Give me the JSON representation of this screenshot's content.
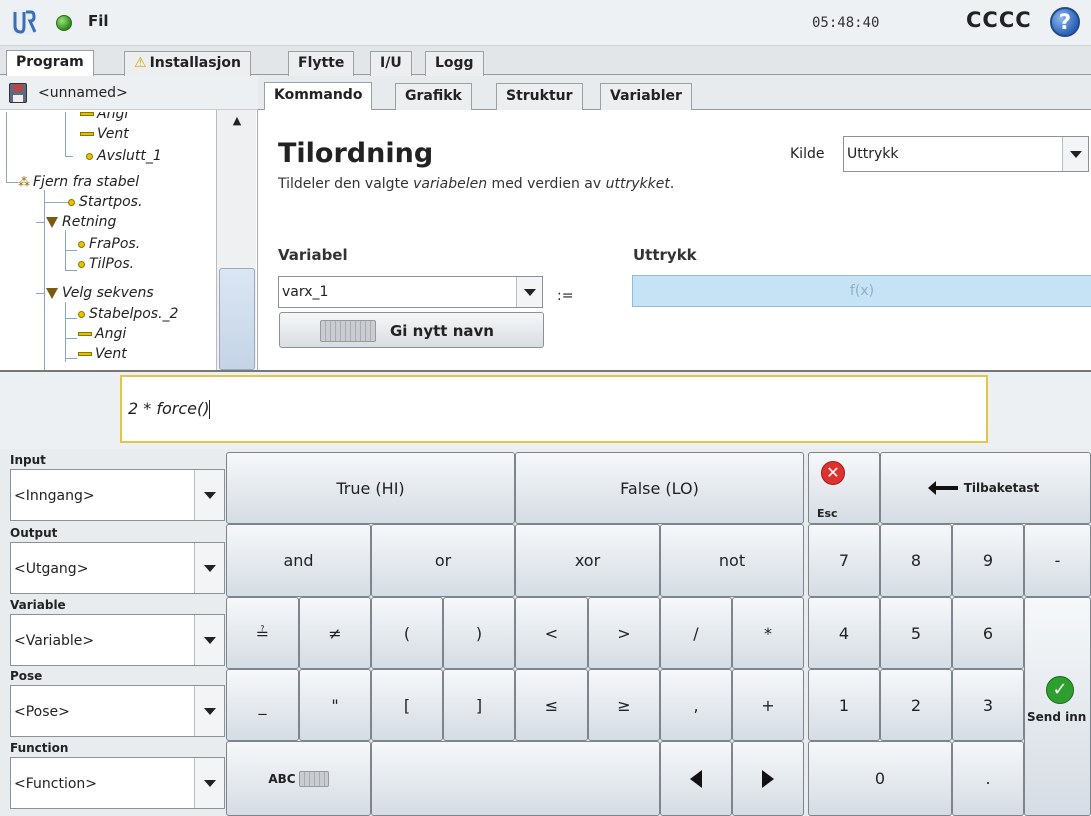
{
  "titlebar": {
    "title": "Fil",
    "time": "05:48:40",
    "robot_name": "CCCC",
    "help": "?"
  },
  "main_tabs": [
    "Program",
    "Installasjon",
    "Flytte",
    "I/U",
    "Logg"
  ],
  "tree": {
    "file_name": "<unnamed>",
    "items": [
      "Angi",
      "Vent",
      "Avslutt_1",
      "Fjern fra stabel",
      "Startpos.",
      "Retning",
      "FraPos.",
      "TilPos.",
      "Velg sekvens",
      "Stabelpos._2",
      "Angi",
      "Vent"
    ]
  },
  "sub_tabs": [
    "Kommando",
    "Grafikk",
    "Struktur",
    "Variabler"
  ],
  "command": {
    "title": "Tilordning",
    "desc_prefix": "Tildeler den valgte ",
    "desc_var": "variabelen",
    "desc_mid": " med verdien av ",
    "desc_expr": "uttrykket",
    "desc_end": ".",
    "kilde_label": "Kilde",
    "kilde_value": "Uttrykk",
    "variable_label": "Variabel",
    "variable_value": "varx_1",
    "assign_op": ":=",
    "expression_label": "Uttrykk",
    "expression_placeholder": "f(x)",
    "rename_label": "Gi nytt navn"
  },
  "expression": {
    "value": "2 * force()"
  },
  "selectors": [
    {
      "label": "Input",
      "value": "<Inngang>"
    },
    {
      "label": "Output",
      "value": "<Utgang>"
    },
    {
      "label": "Variable",
      "value": "<Variable>"
    },
    {
      "label": "Pose",
      "value": "<Pose>"
    },
    {
      "label": "Function",
      "value": "<Function>"
    }
  ],
  "keys": {
    "true": "True (HI)",
    "false": "False (LO)",
    "esc": "Esc",
    "backspace": "Tilbaketast",
    "and": "and",
    "or": "or",
    "xor": "xor",
    "not": "not",
    "eq": "≟",
    "neq": "≠",
    "lparen": "(",
    "rparen": ")",
    "lt": "<",
    "gt": ">",
    "div": "/",
    "mul": "*",
    "underscore": "_",
    "quote": "\"",
    "lbracket": "[",
    "rbracket": "]",
    "le": "≤",
    "ge": "≥",
    "comma": ",",
    "plus": "+",
    "abc": "ABC",
    "n7": "7",
    "n8": "8",
    "n9": "9",
    "minus": "-",
    "n4": "4",
    "n5": "5",
    "n6": "6",
    "n1": "1",
    "n2": "2",
    "n3": "3",
    "n0": "0",
    "dot": ".",
    "send": "Send inn"
  }
}
